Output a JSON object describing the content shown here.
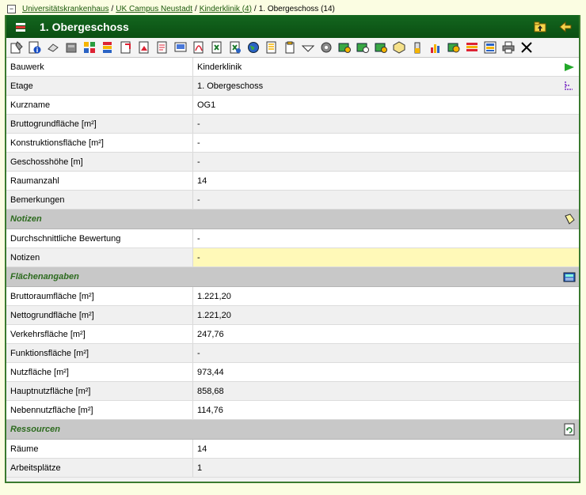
{
  "breadcrumb": {
    "toggle": "−",
    "items": [
      "Universitätskrankenhaus",
      "UK Campus Neustadt",
      "Kinderklinik (4)"
    ],
    "current": "1. Obergeschoss (14)",
    "separator": "/"
  },
  "window": {
    "title": "1. Obergeschoss"
  },
  "toolbar": {
    "icons": [
      "properties-icon",
      "info-icon",
      "eraser-icon",
      "database-icon",
      "grid-icon",
      "stack-icon",
      "export-icon",
      "image-icon",
      "document-icon",
      "scan-icon",
      "pdf-icon",
      "excel-icon",
      "excel2-icon",
      "globe-icon",
      "list-icon",
      "clipboard-icon",
      "truck-icon",
      "tool-icon",
      "edit-icon",
      "clock-icon",
      "sum-icon",
      "cube-icon",
      "bottle-icon",
      "bar-chart-icon",
      "money-icon",
      "gantt-icon",
      "colorchart-icon",
      "print-icon",
      "close-icon"
    ]
  },
  "rows": {
    "bauwerk": {
      "label": "Bauwerk",
      "value": "Kinderklinik"
    },
    "etage": {
      "label": "Etage",
      "value": "1. Obergeschoss"
    },
    "kurzname": {
      "label": "Kurzname",
      "value": "OG1"
    },
    "bgf": {
      "label": "Bruttogrundfläche [m²]",
      "value": "-"
    },
    "kf": {
      "label": "Konstruktionsfläche [m²]",
      "value": "-"
    },
    "gh": {
      "label": "Geschosshöhe [m]",
      "value": "-"
    },
    "raumanzahl": {
      "label": "Raumanzahl",
      "value": "14"
    },
    "bemerkungen": {
      "label": "Bemerkungen",
      "value": "-"
    }
  },
  "sections": {
    "notizen": {
      "title": "Notizen",
      "rows": [
        {
          "label": "Durchschnittliche Bewertung",
          "value": "-"
        },
        {
          "label": "Notizen",
          "value": "-"
        }
      ]
    },
    "flaechen": {
      "title": "Flächenangaben",
      "rows": [
        {
          "label": "Bruttoraumfläche [m²]",
          "value": "1.221,20"
        },
        {
          "label": "Nettogrundfläche [m²]",
          "value": "1.221,20"
        },
        {
          "label": "Verkehrsfläche [m²]",
          "value": "247,76"
        },
        {
          "label": "Funktionsfläche [m²]",
          "value": "-"
        },
        {
          "label": "Nutzfläche [m²]",
          "value": "973,44"
        },
        {
          "label": "Hauptnutzfläche [m²]",
          "value": "858,68"
        },
        {
          "label": "Nebennutzfläche [m²]",
          "value": "114,76"
        }
      ]
    },
    "ressourcen": {
      "title": "Ressourcen",
      "rows": [
        {
          "label": "Räume",
          "value": "14"
        },
        {
          "label": "Arbeitsplätze",
          "value": "1"
        }
      ]
    }
  },
  "colors": {
    "title_bar": "#0f5a18",
    "section_text": "#2d6b1f",
    "highlight": "#fff9b8",
    "page_background": "#fbfde2"
  }
}
